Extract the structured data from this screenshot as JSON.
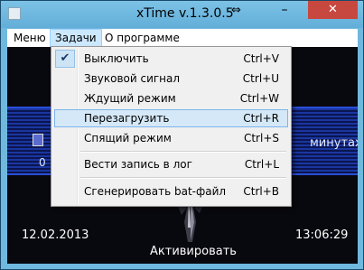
{
  "window": {
    "title": "xTime v.1.3.0.5",
    "resize_icon": "⇔",
    "minimize_label": "–",
    "close_label": "✕"
  },
  "menubar": {
    "items": [
      {
        "label": "Меню"
      },
      {
        "label": "Задачи"
      },
      {
        "label": "О программе"
      }
    ],
    "active_index": 1
  },
  "dropdown": {
    "items": [
      {
        "label": "Выключить",
        "shortcut": "Ctrl+V",
        "checked": true
      },
      {
        "label": "Звуковой сигнал",
        "shortcut": "Ctrl+U"
      },
      {
        "label": "Ждущий режим",
        "shortcut": "Ctrl+W"
      },
      {
        "label": "Перезагрузить",
        "shortcut": "Ctrl+R",
        "hovered": true
      },
      {
        "label": "Спящий режим",
        "shortcut": "Ctrl+S"
      },
      {
        "label": "Вести запись в лог",
        "shortcut": "Ctrl+L"
      },
      {
        "label": "Сгенерировать bat-файл",
        "shortcut": "Ctrl+B"
      }
    ],
    "check_icon": "✔"
  },
  "main": {
    "partial_left_text": "0",
    "partial_right_text": "минутах",
    "date": "12.02.2013",
    "time": "13:06:29",
    "activate_label": "Активировать"
  },
  "colors": {
    "titlebar": "#6fb8de",
    "close_button": "#c7483f",
    "menu_highlight": "#d5e8f7",
    "background": "#08080f",
    "glow_band": "#1a36a0"
  }
}
